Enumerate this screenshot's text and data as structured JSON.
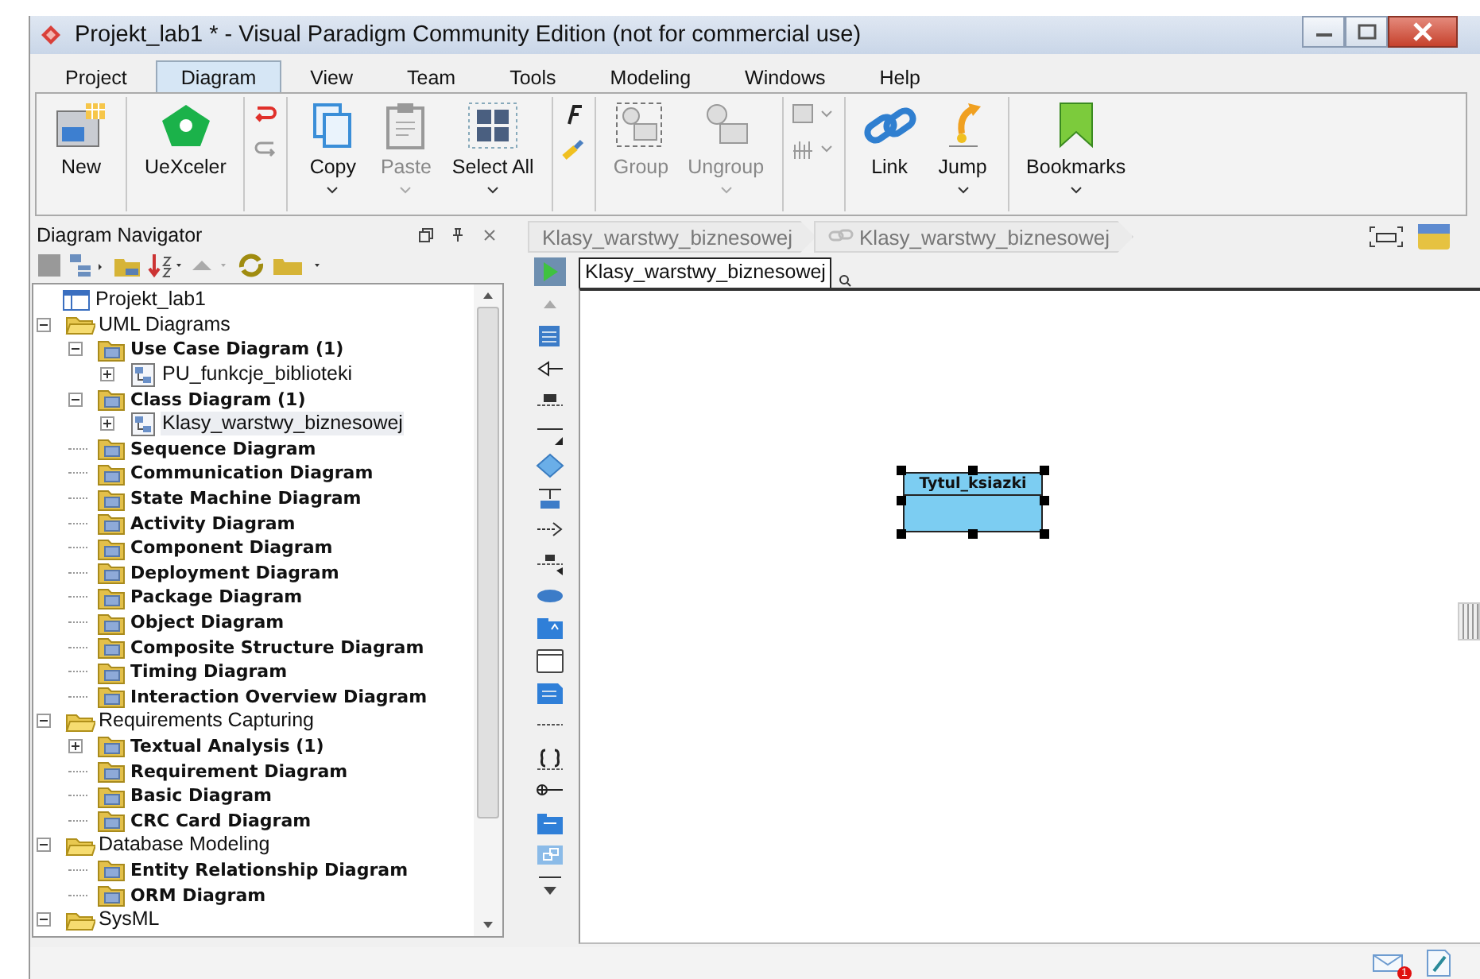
{
  "window": {
    "title": "Projekt_lab1 * - Visual Paradigm Community Edition (not for commercial use)"
  },
  "menu_tabs": [
    {
      "label": "Project",
      "selected": false
    },
    {
      "label": "Diagram",
      "selected": true
    },
    {
      "label": "View",
      "selected": false
    },
    {
      "label": "Team",
      "selected": false
    },
    {
      "label": "Tools",
      "selected": false
    },
    {
      "label": "Modeling",
      "selected": false
    },
    {
      "label": "Windows",
      "selected": false
    },
    {
      "label": "Help",
      "selected": false
    }
  ],
  "ribbon": [
    {
      "items": [
        {
          "kind": "large",
          "label": "New",
          "disabled": false,
          "dropdown": false
        }
      ]
    },
    {
      "items": [
        {
          "kind": "large",
          "label": "UeXceler",
          "disabled": false,
          "dropdown": false
        }
      ]
    },
    {
      "items": [
        {
          "kind": "pair"
        }
      ]
    },
    {
      "items": [
        {
          "kind": "large",
          "label": "Copy",
          "disabled": false,
          "dropdown": true
        },
        {
          "kind": "large",
          "label": "Paste",
          "disabled": true,
          "dropdown": true
        },
        {
          "kind": "large",
          "label": "Select All",
          "disabled": false,
          "dropdown": true
        }
      ]
    },
    {
      "items": [
        {
          "kind": "pair"
        }
      ]
    },
    {
      "items": [
        {
          "kind": "large",
          "label": "Group",
          "disabled": true,
          "dropdown": false
        },
        {
          "kind": "large",
          "label": "Ungroup",
          "disabled": true,
          "dropdown": true
        }
      ]
    },
    {
      "items": [
        {
          "kind": "pair"
        }
      ]
    },
    {
      "items": [
        {
          "kind": "large",
          "label": "Link",
          "disabled": false,
          "dropdown": false
        },
        {
          "kind": "large",
          "label": "Jump",
          "disabled": false,
          "dropdown": true
        }
      ]
    },
    {
      "items": [
        {
          "kind": "large",
          "label": "Bookmarks",
          "disabled": false,
          "dropdown": true
        }
      ]
    }
  ],
  "navigator": {
    "title": "Diagram Navigator",
    "tree": [
      {
        "label": "Projekt_lab1",
        "kind": "project",
        "children": [
          {
            "label": "UML Diagrams",
            "kind": "category",
            "expanded": true,
            "children": [
              {
                "label": "Use Case Diagram (1)",
                "kind": "type",
                "expanded": true,
                "children": [
                  {
                    "label": "PU_funkcje_biblioteki",
                    "kind": "diagram",
                    "expanded": false,
                    "selected": false
                  }
                ]
              },
              {
                "label": "Class Diagram (1)",
                "kind": "type",
                "expanded": true,
                "children": [
                  {
                    "label": "Klasy_warstwy_biznesowej",
                    "kind": "diagram",
                    "expanded": false,
                    "selected": true
                  }
                ]
              },
              {
                "label": "Sequence Diagram",
                "kind": "type"
              },
              {
                "label": "Communication Diagram",
                "kind": "type"
              },
              {
                "label": "State Machine Diagram",
                "kind": "type"
              },
              {
                "label": "Activity Diagram",
                "kind": "type"
              },
              {
                "label": "Component Diagram",
                "kind": "type"
              },
              {
                "label": "Deployment Diagram",
                "kind": "type"
              },
              {
                "label": "Package Diagram",
                "kind": "type"
              },
              {
                "label": "Object Diagram",
                "kind": "type"
              },
              {
                "label": "Composite Structure Diagram",
                "kind": "type"
              },
              {
                "label": "Timing Diagram",
                "kind": "type"
              },
              {
                "label": "Interaction Overview Diagram",
                "kind": "type"
              }
            ]
          },
          {
            "label": "Requirements Capturing",
            "kind": "category",
            "expanded": true,
            "children": [
              {
                "label": "Textual Analysis (1)",
                "kind": "type",
                "expanded": false
              },
              {
                "label": "Requirement Diagram",
                "kind": "type"
              },
              {
                "label": "Basic Diagram",
                "kind": "type"
              },
              {
                "label": "CRC Card Diagram",
                "kind": "type"
              }
            ]
          },
          {
            "label": "Database Modeling",
            "kind": "category",
            "expanded": true,
            "children": [
              {
                "label": "Entity Relationship Diagram",
                "kind": "type"
              },
              {
                "label": "ORM Diagram",
                "kind": "type"
              }
            ]
          },
          {
            "label": "SysML",
            "kind": "category",
            "expanded": true
          }
        ]
      }
    ]
  },
  "breadcrumb": [
    {
      "label": "Klasy_warstwy_biznesowej"
    },
    {
      "label": "Klasy_warstwy_biznesowej"
    }
  ],
  "diagram_name": "Klasy_warstwy_biznesowej",
  "canvas": {
    "classes": [
      {
        "name": "Tytul_ksiazki",
        "selected": true
      }
    ]
  },
  "status_bar": {
    "notification_count": "1"
  }
}
